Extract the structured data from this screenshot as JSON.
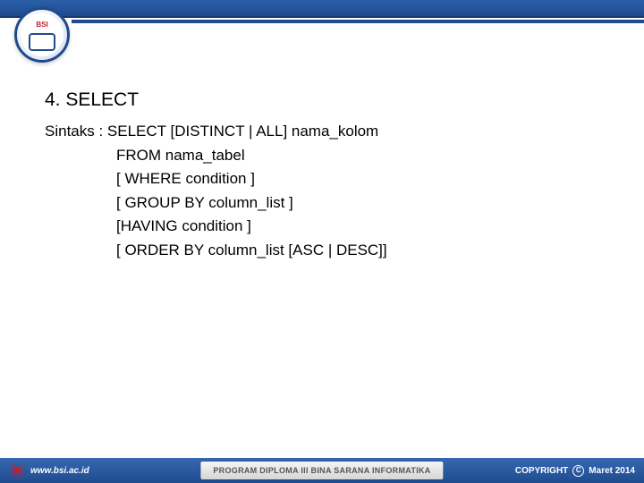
{
  "logo": {
    "org": "BSI"
  },
  "content": {
    "heading": "4.  SELECT",
    "lines": [
      "Sintaks : SELECT [DISTINCT | ALL] nama_kolom",
      "FROM nama_tabel",
      "[ WHERE condition ]",
      "[ GROUP BY column_list ]",
      "[HAVING condition ]",
      "[ ORDER BY column_list [ASC | DESC]]"
    ]
  },
  "footer": {
    "url": "www.bsi.ac.id",
    "program": "PROGRAM DIPLOMA III BINA SARANA INFORMATIKA",
    "copyright_label": "COPYRIGHT",
    "copyright_symbol": "C",
    "date": "Maret 2014"
  }
}
